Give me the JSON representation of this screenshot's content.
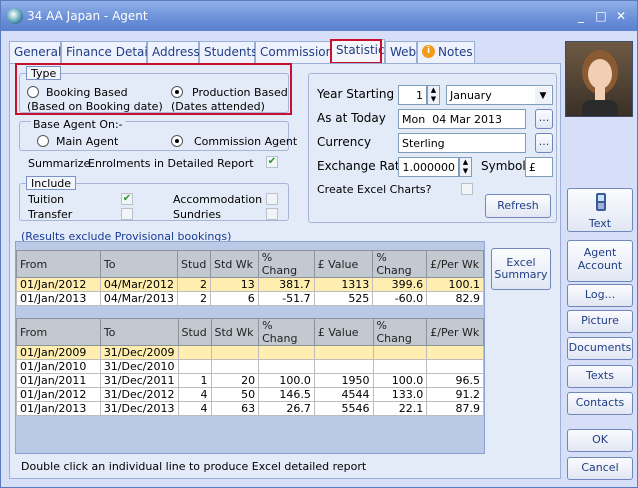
{
  "window": {
    "title": "34 AA Japan - Agent",
    "min": "_",
    "max": "□",
    "close": "✕"
  },
  "tabs": [
    "General",
    "Finance Details",
    "Address",
    "Students",
    "Commissions",
    "Statistics",
    "Web",
    "Notes"
  ],
  "active_tab": "Statistics",
  "type_group": {
    "title": "Type",
    "booking_based": "Booking Based",
    "booking_based_sub": "(Based on Booking date)",
    "production_based": "Production Based",
    "production_based_sub": "(Dates attended)",
    "selected": "Production Based"
  },
  "base_agent": {
    "title": "Base Agent On:-",
    "main": "Main Agent",
    "commission": "Commission Agent",
    "selected": "Commission Agent"
  },
  "summarize": {
    "label": "Summarize",
    "text": "Enrolments in Detailed Report",
    "checked": true
  },
  "include": {
    "title": "Include",
    "tuition": "Tuition",
    "tuition_checked": true,
    "transfer": "Transfer",
    "transfer_checked": false,
    "accommodation": "Accommodation",
    "accommodation_checked": false,
    "sundries": "Sundries",
    "sundries_checked": false
  },
  "settings": {
    "year_starting_label": "Year Starting",
    "year_day": "1",
    "year_month": "January",
    "as_at_label": "As at Today",
    "as_at_day": "Mon",
    "as_at_date": "04 Mar 2013",
    "currency_label": "Currency",
    "currency": "Sterling",
    "exchange_label": "Exchange Rate",
    "exchange_rate": "1.000000",
    "symbol_label": "Symbol",
    "symbol": "£",
    "excel_charts_label": "Create Excel Charts?",
    "refresh": "Refresh"
  },
  "results_note": "(Results exclude Provisional bookings)",
  "excel_summary": [
    "Excel",
    "Summary"
  ],
  "columns": [
    "From",
    "To",
    "Stud",
    "Std Wk",
    "% Chang",
    "£ Value",
    "% Chang",
    "£/Per Wk"
  ],
  "table1": [
    [
      "01/Jan/2012",
      "04/Mar/2012",
      "2",
      "13",
      "381.7",
      "1313",
      "399.6",
      "100.1"
    ],
    [
      "01/Jan/2013",
      "04/Mar/2013",
      "2",
      "6",
      "-51.7",
      "525",
      "-60.0",
      "82.9"
    ]
  ],
  "table2": [
    [
      "01/Jan/2009",
      "31/Dec/2009",
      "",
      "",
      "",
      "",
      "",
      ""
    ],
    [
      "01/Jan/2010",
      "31/Dec/2010",
      "",
      "",
      "",
      "",
      "",
      ""
    ],
    [
      "01/Jan/2011",
      "31/Dec/2011",
      "1",
      "20",
      "100.0",
      "1950",
      "100.0",
      "96.5"
    ],
    [
      "01/Jan/2012",
      "31/Dec/2012",
      "4",
      "50",
      "146.5",
      "4544",
      "133.0",
      "91.2"
    ],
    [
      "01/Jan/2013",
      "31/Dec/2013",
      "4",
      "63",
      "26.7",
      "5546",
      "22.1",
      "87.9"
    ]
  ],
  "footer_hint": "Double click an individual line to produce Excel detailed report",
  "side_buttons": [
    "Text",
    "Agent Account",
    "Log...",
    "Picture",
    "Documents",
    "Texts",
    "Contacts",
    "OK",
    "Cancel"
  ]
}
